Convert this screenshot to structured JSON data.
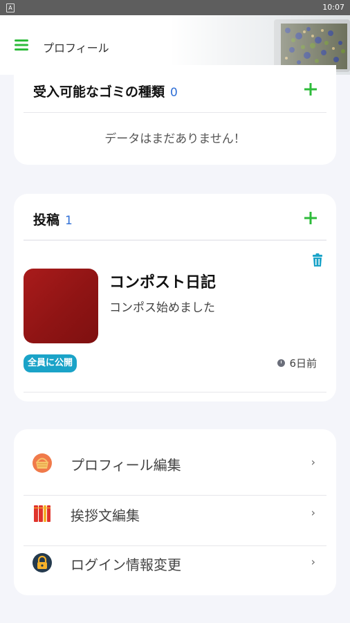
{
  "status_bar": {
    "icon": "A",
    "time": "10:07"
  },
  "app_bar": {
    "title": "プロフィール",
    "menu_icon": "hamburger-menu-icon"
  },
  "waste_types_card": {
    "title": "受入可能なゴミの種類",
    "count": "0",
    "add_icon": "plus-icon",
    "empty_message": "データはまだありません！"
  },
  "posts_card": {
    "title": "投稿",
    "count": "1",
    "add_icon": "plus-icon",
    "posts": [
      {
        "title": "コンポスト日記",
        "body": "コンポス始めました",
        "visibility": "全員に公開",
        "time_ago": "6日前",
        "delete_icon": "trash-icon"
      }
    ]
  },
  "settings_menu": {
    "items": [
      {
        "label": "プロフィール編集",
        "icon": "basket-icon"
      },
      {
        "label": "挨拶文編集",
        "icon": "books-icon"
      },
      {
        "label": "ログイン情報変更",
        "icon": "lock-icon"
      }
    ],
    "chevron": "›"
  },
  "colors": {
    "accent_green": "#2dbb3a",
    "count_blue": "#2f6fd6",
    "badge_cyan": "#1aa3c8",
    "thumb_red": "#9b1818"
  }
}
